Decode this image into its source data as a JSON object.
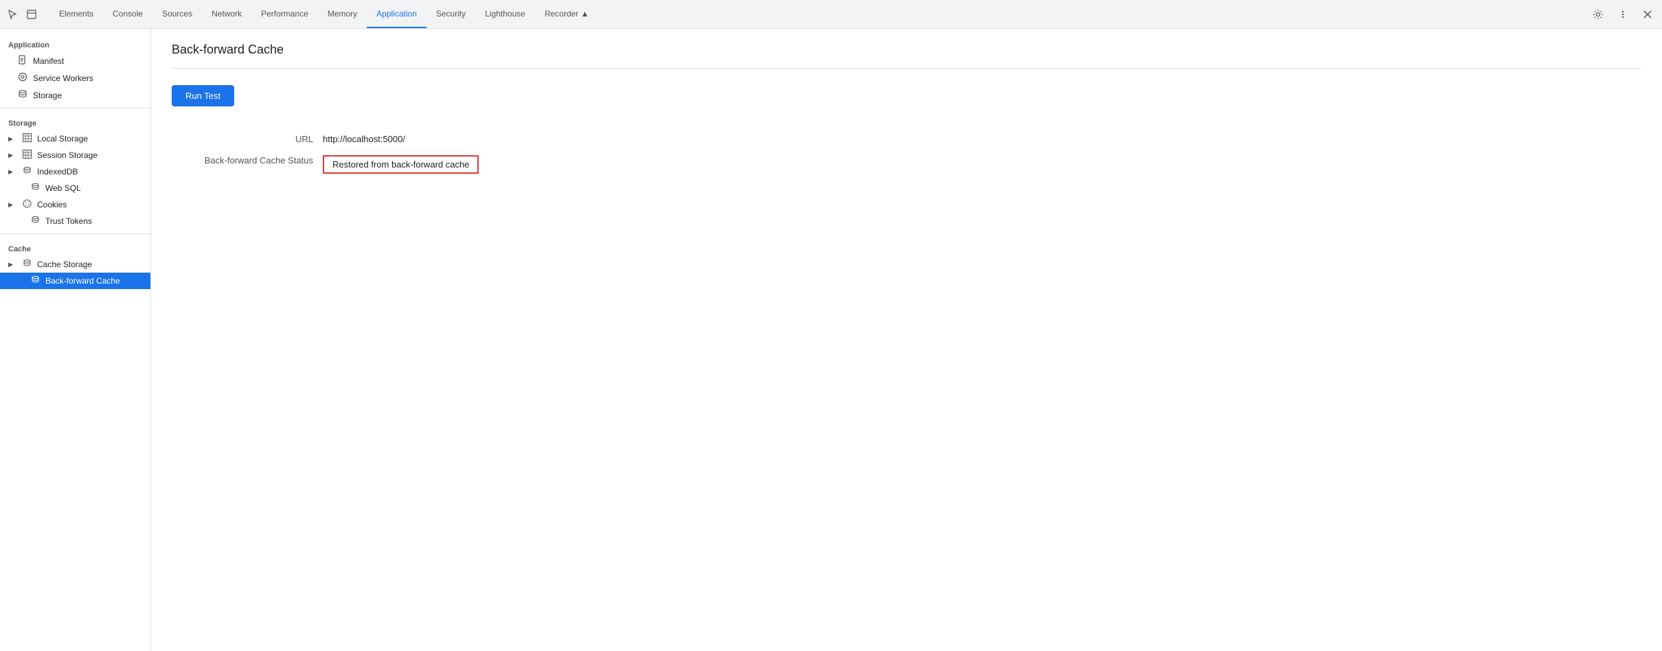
{
  "tabbar": {
    "tabs": [
      {
        "label": "Elements",
        "active": false
      },
      {
        "label": "Console",
        "active": false
      },
      {
        "label": "Sources",
        "active": false
      },
      {
        "label": "Network",
        "active": false
      },
      {
        "label": "Performance",
        "active": false
      },
      {
        "label": "Memory",
        "active": false
      },
      {
        "label": "Application",
        "active": true
      },
      {
        "label": "Security",
        "active": false
      },
      {
        "label": "Lighthouse",
        "active": false
      },
      {
        "label": "Recorder ▲",
        "active": false
      }
    ]
  },
  "sidebar": {
    "section_application": "Application",
    "section_storage": "Storage",
    "section_cache": "Cache",
    "items_application": [
      {
        "label": "Manifest",
        "icon": "📄",
        "type": "plain"
      },
      {
        "label": "Service Workers",
        "icon": "⚙",
        "type": "plain"
      },
      {
        "label": "Storage",
        "icon": "🗄",
        "type": "plain"
      }
    ],
    "items_storage": [
      {
        "label": "Local Storage",
        "icon": "⊞",
        "type": "expandable"
      },
      {
        "label": "Session Storage",
        "icon": "⊞",
        "type": "expandable"
      },
      {
        "label": "IndexedDB",
        "icon": "🗄",
        "type": "expandable"
      },
      {
        "label": "Web SQL",
        "icon": "🗄",
        "type": "plain"
      },
      {
        "label": "Cookies",
        "icon": "✿",
        "type": "expandable"
      },
      {
        "label": "Trust Tokens",
        "icon": "🗄",
        "type": "plain"
      }
    ],
    "items_cache": [
      {
        "label": "Cache Storage",
        "icon": "🗄",
        "type": "expandable"
      },
      {
        "label": "Back-forward Cache",
        "icon": "🗄",
        "type": "plain",
        "active": true
      }
    ]
  },
  "content": {
    "title": "Back-forward Cache",
    "run_test_label": "Run Test",
    "url_label": "URL",
    "url_value": "http://localhost:5000/",
    "status_label": "Back-forward Cache Status",
    "status_value": "Restored from back-forward cache"
  }
}
